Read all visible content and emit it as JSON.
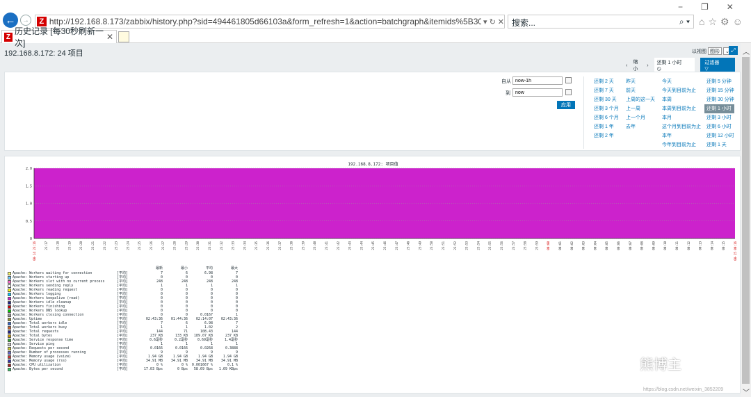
{
  "browser": {
    "url": "http://192.168.8.173/zabbix/history.php?sid=494461805d66103a&form_refresh=1&action=batchgraph&itemids%5B30681%5D",
    "search_placeholder": "搜索...",
    "tab_title": "历史记录 [每30秒刷新一次]",
    "zicon": "Z"
  },
  "page": {
    "title": "192.168.8.172: 24 项目",
    "view_as_label": "以视图",
    "view_as_value": "图形"
  },
  "filter_tabs": {
    "prev": "‹",
    "zoom_out": "缩小",
    "next": "›",
    "time": "还剩 1 小时",
    "filter": "过滤器"
  },
  "filter": {
    "from_label": "自从",
    "from_value": "now-1h",
    "to_label": "到",
    "to_value": "now",
    "apply": "应用",
    "quick": [
      [
        "还剩 2 天",
        "还剩 7 天",
        "还剩 30 天",
        "还剩 3 个月",
        "还剩 6 个月",
        "还剩 1 年",
        "还剩 2 年"
      ],
      [
        "昨天",
        "前天",
        "上周的这一天",
        "上一周",
        "上一个月",
        "去年"
      ],
      [
        "今天",
        "今天到目前为止",
        "本周",
        "本周到目前为止",
        "本月",
        "这个月到目前为止",
        "本年",
        "今年到目前为止"
      ],
      [
        "还剩 5 分钟",
        "还剩 15 分钟",
        "还剩 30 分钟",
        "还剩 1 小时",
        "还剩 3 小时",
        "还剩 6 小时",
        "还剩 12 小时",
        "还剩 1 天"
      ]
    ]
  },
  "chart_data": {
    "type": "area",
    "title": "192.168.8.172: 项目值",
    "ylim": [
      0,
      2.0
    ],
    "y_ticks": [
      "2.0",
      "1.5",
      "1.0",
      "0.5",
      "0"
    ],
    "fill_color": "#cc22cc",
    "x_start": "08-14 23:16",
    "x_end": "08-15 00:16",
    "x_ticks": [
      "23:17",
      "23:18",
      "23:19",
      "23:20",
      "23:21",
      "23:22",
      "23:23",
      "23:24",
      "23:25",
      "23:26",
      "23:27",
      "23:28",
      "23:29",
      "23:30",
      "23:31",
      "23:32",
      "23:33",
      "23:34",
      "23:35",
      "23:36",
      "23:37",
      "23:38",
      "23:39",
      "23:40",
      "23:41",
      "23:42",
      "23:43",
      "23:44",
      "23:45",
      "23:46",
      "23:47",
      "23:48",
      "23:49",
      "23:50",
      "23:51",
      "23:52",
      "23:53",
      "23:54",
      "23:55",
      "23:56",
      "23:57",
      "23:58",
      "23:59",
      "00:00",
      "00:01",
      "00:02",
      "00:03",
      "00:04",
      "00:05",
      "00:06",
      "00:07",
      "00:08",
      "00:09",
      "00:10",
      "00:11",
      "00:12",
      "00:13",
      "00:14",
      "00:15"
    ],
    "legend_headers": [
      "最新",
      "最小",
      "平均",
      "最大"
    ],
    "series": [
      {
        "name": "Apache: Workers waiting for connection",
        "fn": "[平均]",
        "color": "#ffff66",
        "last": "7",
        "min": "6",
        "avg": "6.98",
        "max": "7"
      },
      {
        "name": "Apache: Workers starting up",
        "fn": "[平均]",
        "color": "#66ccff",
        "last": "0",
        "min": "0",
        "avg": "0",
        "max": "0"
      },
      {
        "name": "Apache: Workers slot with no current process",
        "fn": "[平均]",
        "color": "#ff66cc",
        "last": "248",
        "min": "248",
        "avg": "248",
        "max": "248"
      },
      {
        "name": "Apache: Workers sending reply",
        "fn": "[平均]",
        "color": "#ffffff",
        "last": "1",
        "min": "1",
        "avg": "1",
        "max": "1"
      },
      {
        "name": "Apache: Workers reading request",
        "fn": "[平均]",
        "color": "#ffff00",
        "last": "0",
        "min": "0",
        "avg": "0",
        "max": "0"
      },
      {
        "name": "Apache: Workers logging",
        "fn": "[平均]",
        "color": "#00ccff",
        "last": "0",
        "min": "0",
        "avg": "0",
        "max": "0"
      },
      {
        "name": "Apache: Workers keepalive (read)",
        "fn": "[平均]",
        "color": "#cc22cc",
        "last": "0",
        "min": "0",
        "avg": "0",
        "max": "0"
      },
      {
        "name": "Apache: Workers idle cleanup",
        "fn": "[平均]",
        "color": "#222288",
        "last": "0",
        "min": "0",
        "avg": "0",
        "max": "0"
      },
      {
        "name": "Apache: Workers finishing",
        "fn": "[平均]",
        "color": "#cc0000",
        "last": "0",
        "min": "0",
        "avg": "0",
        "max": "0"
      },
      {
        "name": "Apache: Workers DNS lookup",
        "fn": "[平均]",
        "color": "#00cc00",
        "last": "0",
        "min": "0",
        "avg": "0",
        "max": "0"
      },
      {
        "name": "Apache: Workers closing connection",
        "fn": "[平均]",
        "color": "#999999",
        "last": "0",
        "min": "0",
        "avg": "0.0167",
        "max": "1"
      },
      {
        "name": "Apache: Uptime",
        "fn": "[平均]",
        "color": "#999933",
        "last": "02:43:36",
        "min": "01:44:36",
        "avg": "02:14:07",
        "max": "02:43:36"
      },
      {
        "name": "Apache: Total workers idle",
        "fn": "[平均]",
        "color": "#3366cc",
        "last": "7",
        "min": "6",
        "avg": "6.98",
        "max": "7"
      },
      {
        "name": "Apache: Total workers busy",
        "fn": "[平均]",
        "color": "#cc6633",
        "last": "1",
        "min": "1",
        "avg": "1.02",
        "max": "2"
      },
      {
        "name": "Apache: Total requests",
        "fn": "[平均]",
        "color": "#222288",
        "last": "144",
        "min": "71",
        "avg": "108.43",
        "max": "144"
      },
      {
        "name": "Apache: Total bytes",
        "fn": "[平均]",
        "color": "#cc9900",
        "last": "237 KB",
        "min": "133 KB",
        "avg": "189.07 KB",
        "max": "237 KB"
      },
      {
        "name": "Apache: Service response time",
        "fn": "[平均]",
        "color": "#33aa33",
        "last": "0.6毫秒",
        "min": "0.2毫秒",
        "avg": "0.69毫秒",
        "max": "1.4毫秒"
      },
      {
        "name": "Apache: Service ping",
        "fn": "[平均]",
        "color": "#cccccc",
        "last": "1",
        "min": "1",
        "avg": "1",
        "max": "1"
      },
      {
        "name": "Apache: Requests per second",
        "fn": "[平均]",
        "color": "#cccc33",
        "last": "0.0166",
        "min": "0.0166",
        "avg": "0.0268",
        "max": "0.3888"
      },
      {
        "name": "Apache: Number of processes running",
        "fn": "[平均]",
        "color": "#6666cc",
        "last": "9",
        "min": "9",
        "avg": "9",
        "max": "9"
      },
      {
        "name": "Apache: Memory usage (vsize)",
        "fn": "[平均]",
        "color": "#cc3333",
        "last": "1.94 GB",
        "min": "1.94 GB",
        "avg": "1.94 GB",
        "max": "1.94 GB"
      },
      {
        "name": "Apache: Memory usage (rss)",
        "fn": "[平均]",
        "color": "#3333aa",
        "last": "34.91 MB",
        "min": "34.91 MB",
        "avg": "34.91 MB",
        "max": "34.91 MB"
      },
      {
        "name": "Apache: CPU utilization",
        "fn": "[平均]",
        "color": "#aa2222",
        "last": "0 %",
        "min": "0 %",
        "avg": "0.001667 %",
        "max": "0.1 %"
      },
      {
        "name": "Apache: Bytes per second",
        "fn": "[平均]",
        "color": "#33cc66",
        "last": "17.03 Bps",
        "min": "0 Bps",
        "avg": "58.69 Bps",
        "max": "1.69 KBps"
      }
    ]
  },
  "watermark": {
    "text": "熊博主",
    "url": "https://blog.csdn.net/weixin_3852209"
  }
}
